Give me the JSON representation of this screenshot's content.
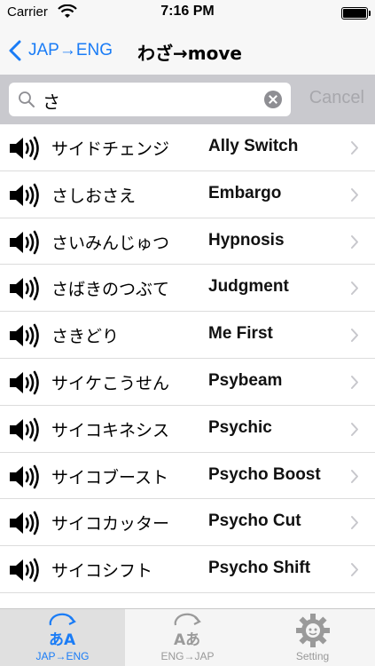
{
  "status_bar": {
    "carrier": "Carrier",
    "time": "7:16 PM"
  },
  "nav": {
    "back_label": "JAP→ENG",
    "title": "わざ→move"
  },
  "search": {
    "query": "さ",
    "cancel_label": "Cancel"
  },
  "rows": [
    {
      "jp": "サイドチェンジ",
      "en": "Ally Switch"
    },
    {
      "jp": "さしおさえ",
      "en": "Embargo"
    },
    {
      "jp": "さいみんじゅつ",
      "en": "Hypnosis"
    },
    {
      "jp": "さばきのつぶて",
      "en": "Judgment"
    },
    {
      "jp": "さきどり",
      "en": "Me First"
    },
    {
      "jp": "サイケこうせん",
      "en": "Psybeam"
    },
    {
      "jp": "サイコキネシス",
      "en": "Psychic"
    },
    {
      "jp": "サイコブースト",
      "en": "Psycho Boost"
    },
    {
      "jp": "サイコカッター",
      "en": "Psycho Cut"
    },
    {
      "jp": "サイコシフト",
      "en": "Psycho Shift"
    }
  ],
  "tabs": [
    {
      "label": "JAP→ENG",
      "icon_text": "あA",
      "active": true
    },
    {
      "label": "ENG→JAP",
      "icon_text": "Aあ",
      "active": false
    },
    {
      "label": "Setting",
      "active": false
    }
  ],
  "colors": {
    "accent": "#1a7cf6",
    "search_bar_bg": "#c9c9ce",
    "cancel_text": "#a7a7ac"
  },
  "icons": {
    "speaker": "speaker-icon",
    "chevron": "chevron-right-icon",
    "settings": "gear-icon"
  }
}
